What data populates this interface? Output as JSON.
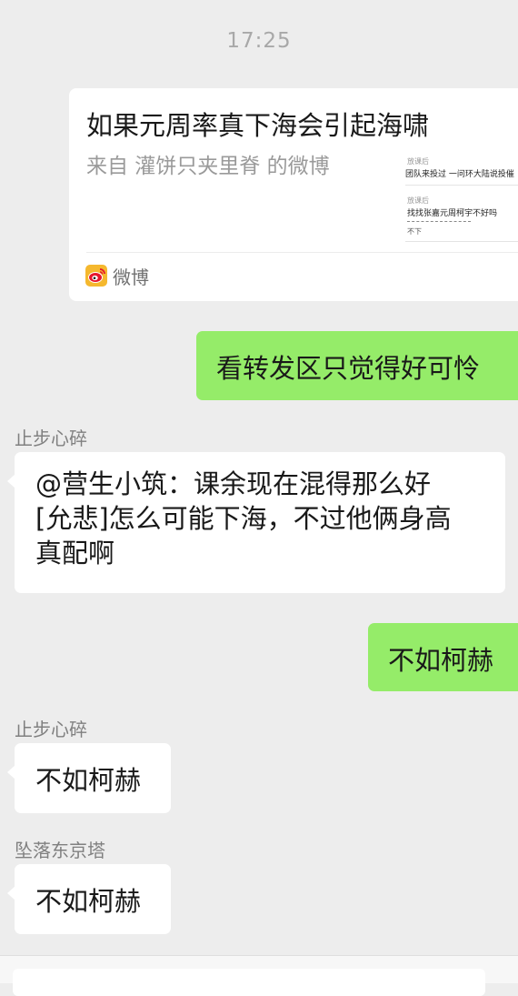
{
  "status": {
    "time": "17:25"
  },
  "shared_card": {
    "title": "如果元周率真下海会引起海啸",
    "source": "来自 灌饼只夹里脊 的微博",
    "app_label": "微博",
    "thumbnail": {
      "row1_small": "放课后",
      "row1_text": "团队来投过 一问环大陆说投催",
      "row2_small": "放课后",
      "row2_text": "找找张嘉元周柯宇不好吗",
      "row3_text": "不下"
    }
  },
  "messages": [
    {
      "side": "right",
      "text": "看转发区只觉得好可怜"
    },
    {
      "side": "left",
      "sender": "止步心碎",
      "lines": [
        "@营生小筑：课余现在混得那么好",
        "[允悲]怎么可能下海，不过他俩身高",
        "真配啊"
      ]
    },
    {
      "side": "right",
      "text": "不如柯赫"
    },
    {
      "side": "left",
      "sender": "止步心碎",
      "text": "不如柯赫"
    },
    {
      "side": "left",
      "sender": "坠落东京塔",
      "text": "不如柯赫"
    }
  ],
  "colors": {
    "background": "#ededed",
    "self_bubble": "#95ec69",
    "other_bubble": "#ffffff",
    "weibo_red": "#e6162d",
    "weibo_yellow": "#f5a623"
  }
}
